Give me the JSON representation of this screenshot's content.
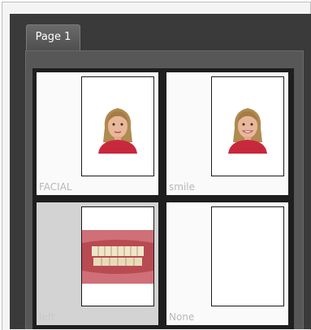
{
  "tabs": [
    {
      "label": "Page 1",
      "active": true
    }
  ],
  "cells": [
    {
      "label": "FACIAL",
      "image": "girl-portrait-photo",
      "selected": false
    },
    {
      "label": "smile",
      "image": "girl-portrait-photo",
      "selected": false
    },
    {
      "label": "left",
      "image": "intraoral-teeth-photo",
      "selected": true
    },
    {
      "label": "None",
      "image": "empty-photo-slot",
      "selected": false
    }
  ],
  "colors": {
    "panel": "#3a3a3a",
    "page": "#575757",
    "cell": "#fafafa",
    "selected_cell": "#d3d3d3",
    "label": "#b8b8b8"
  }
}
